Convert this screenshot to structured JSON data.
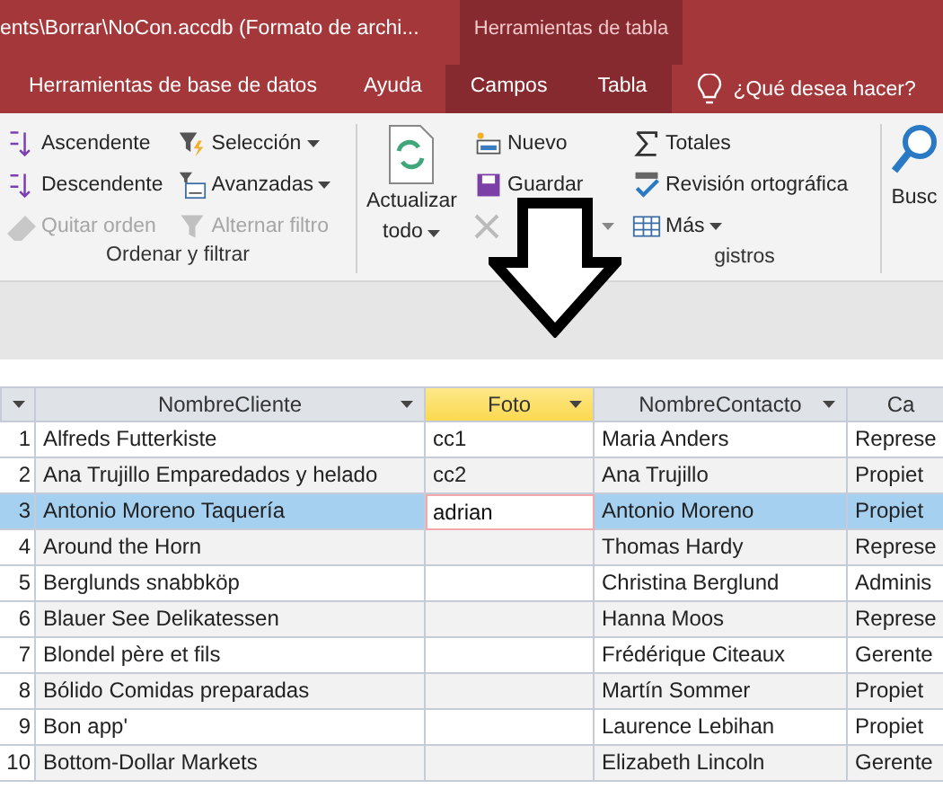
{
  "window": {
    "title": "ents\\Borrar\\NoCon.accdb (Formato de archi..."
  },
  "contextual_group": {
    "label": "Herramientas de tabla"
  },
  "tabs": [
    {
      "label": "Herramientas de base de datos",
      "selected": false,
      "contextual": false
    },
    {
      "label": "Ayuda",
      "selected": false,
      "contextual": false
    },
    {
      "label": "Campos",
      "selected": false,
      "contextual": true
    },
    {
      "label": "Tabla",
      "selected": false,
      "contextual": true
    }
  ],
  "tell_me": {
    "placeholder": "¿Qué desea hacer?"
  },
  "ribbon": {
    "groups": [
      {
        "label": "Ordenar y filtrar",
        "columns": [
          [
            {
              "label": "Ascendente",
              "disabled": false,
              "dropdown": false
            },
            {
              "label": "Descendente",
              "disabled": false,
              "dropdown": false
            },
            {
              "label": "Quitar orden",
              "disabled": true,
              "dropdown": false
            }
          ],
          [
            {
              "label": "Selección",
              "disabled": false,
              "dropdown": true
            },
            {
              "label": "Avanzadas",
              "disabled": false,
              "dropdown": true
            },
            {
              "label": "Alternar filtro",
              "disabled": true,
              "dropdown": false
            }
          ]
        ]
      },
      {
        "label": "gistros",
        "large": {
          "label_lines": [
            "Actualizar",
            "todo"
          ],
          "dropdown": true
        },
        "columns": [
          [
            {
              "label": "Nuevo",
              "disabled": false,
              "dropdown": false
            },
            {
              "label": "Guardar",
              "disabled": false,
              "dropdown": false
            },
            {
              "disabled": true,
              "dropdown": true
            }
          ],
          [
            {
              "label": "Totales",
              "disabled": false,
              "dropdown": false
            },
            {
              "label": "Revisión ortográfica",
              "disabled": false,
              "dropdown": false
            },
            {
              "label": "Más",
              "disabled": false,
              "dropdown": true
            }
          ]
        ]
      },
      {
        "large": {
          "label_lines": [
            "Busc"
          ],
          "dropdown": false
        }
      }
    ]
  },
  "table": {
    "columns": [
      {
        "label": "NombreCliente",
        "active": false,
        "dropdown": true
      },
      {
        "label": "Foto",
        "active": true,
        "dropdown": true
      },
      {
        "label": "NombreContacto",
        "active": false,
        "dropdown": true
      },
      {
        "label": "Ca",
        "active": false,
        "dropdown": false
      }
    ],
    "rows": [
      {
        "number": "1",
        "selected": false,
        "editing": false,
        "cells": [
          "Alfreds Futterkiste",
          "cc1",
          "Maria Anders",
          "Represe"
        ]
      },
      {
        "number": "2",
        "selected": false,
        "editing": false,
        "cells": [
          "Ana Trujillo Emparedados y helado",
          "cc2",
          "Ana Trujillo",
          "Propiet"
        ]
      },
      {
        "number": "3",
        "selected": true,
        "editing": true,
        "cells": [
          "Antonio Moreno Taquería",
          "adrian",
          "Antonio Moreno",
          "Propiet"
        ]
      },
      {
        "number": "4",
        "selected": false,
        "editing": false,
        "cells": [
          "Around the Horn",
          "",
          "Thomas Hardy",
          "Represe"
        ]
      },
      {
        "number": "5",
        "selected": false,
        "editing": false,
        "cells": [
          "Berglunds snabbköp",
          "",
          "Christina Berglund",
          "Adminis"
        ]
      },
      {
        "number": "6",
        "selected": false,
        "editing": false,
        "cells": [
          "Blauer See Delikatessen",
          "",
          "Hanna Moos",
          "Represe"
        ]
      },
      {
        "number": "7",
        "selected": false,
        "editing": false,
        "cells": [
          "Blondel père et fils",
          "",
          "Frédérique Citeaux",
          "Gerente"
        ]
      },
      {
        "number": "8",
        "selected": false,
        "editing": false,
        "cells": [
          "Bólido Comidas preparadas",
          "",
          "Martín Sommer",
          "Propiet"
        ]
      },
      {
        "number": "9",
        "selected": false,
        "editing": false,
        "cells": [
          "Bon app'",
          "",
          "Laurence Lebihan",
          "Propiet"
        ]
      },
      {
        "number": "10",
        "selected": false,
        "editing": false,
        "cells": [
          "Bottom-Dollar Markets",
          "",
          "Elizabeth Lincoln",
          "Gerente"
        ]
      }
    ]
  }
}
